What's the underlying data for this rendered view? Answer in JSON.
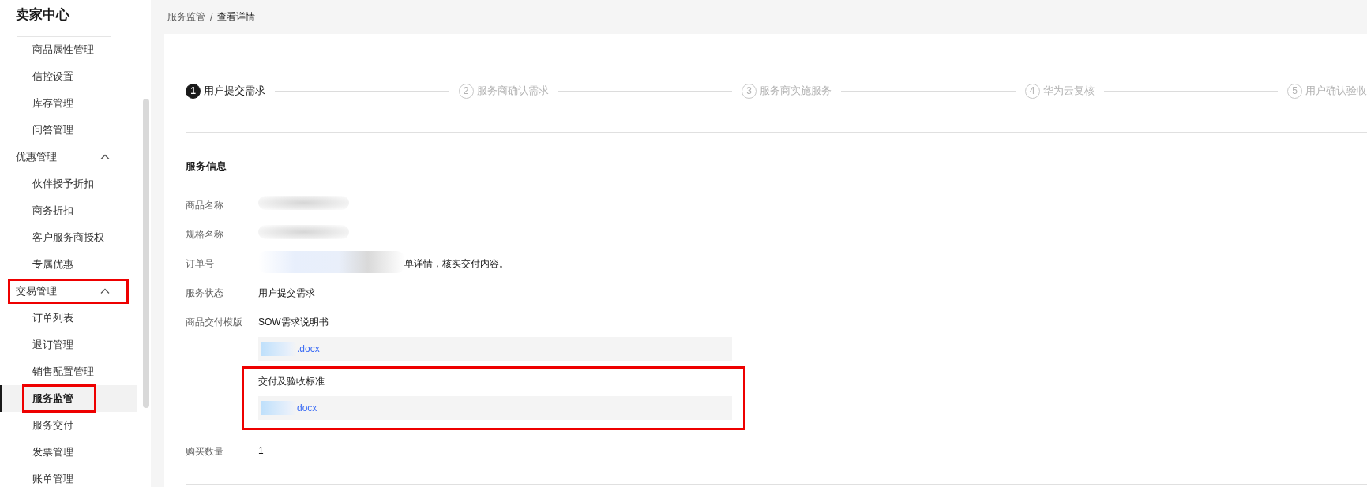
{
  "sidebar": {
    "title": "卖家中心",
    "orphan_items": [
      {
        "label": "商品属性管理",
        "selected": false,
        "annotated": false
      },
      {
        "label": "信控设置",
        "selected": false,
        "annotated": false
      },
      {
        "label": "库存管理",
        "selected": false,
        "annotated": false
      },
      {
        "label": "问答管理",
        "selected": false,
        "annotated": false
      }
    ],
    "groups": [
      {
        "label": "优惠管理",
        "expanded": true,
        "annotated": false,
        "children": [
          {
            "label": "伙伴授予折扣",
            "selected": false,
            "annotated": false
          },
          {
            "label": "商务折扣",
            "selected": false,
            "annotated": false
          },
          {
            "label": "客户服务商授权",
            "selected": false,
            "annotated": false
          },
          {
            "label": "专属优惠",
            "selected": false,
            "annotated": false
          }
        ]
      },
      {
        "label": "交易管理",
        "expanded": true,
        "annotated": true,
        "children": [
          {
            "label": "订单列表",
            "selected": false,
            "annotated": false
          },
          {
            "label": "退订管理",
            "selected": false,
            "annotated": false
          },
          {
            "label": "销售配置管理",
            "selected": false,
            "annotated": false
          },
          {
            "label": "服务监管",
            "selected": true,
            "annotated": true
          },
          {
            "label": "服务交付",
            "selected": false,
            "annotated": false
          },
          {
            "label": "发票管理",
            "selected": false,
            "annotated": false
          },
          {
            "label": "账单管理",
            "selected": false,
            "annotated": false
          }
        ]
      }
    ]
  },
  "breadcrumb": {
    "items": [
      "服务监管",
      "查看详情"
    ],
    "separator": "/"
  },
  "steps": [
    {
      "number": "1",
      "label": "用户提交需求",
      "selected": true
    },
    {
      "number": "2",
      "label": "服务商确认需求",
      "selected": false
    },
    {
      "number": "3",
      "label": "服务商实施服务",
      "selected": false
    },
    {
      "number": "4",
      "label": "华为云复核",
      "selected": false
    },
    {
      "number": "5",
      "label": "用户确认验收",
      "selected": false
    }
  ],
  "section_title": "服务信息",
  "fields": [
    {
      "kind": "text",
      "label": "商品名称",
      "redacted": true
    },
    {
      "kind": "text",
      "label": "规格名称",
      "redacted": true
    },
    {
      "kind": "text",
      "label": "订单号",
      "redacted": true,
      "value": "单详情，核实交付内容。"
    },
    {
      "kind": "text",
      "label": "服务状态",
      "redacted": false,
      "value": "用户提交需求"
    },
    {
      "kind": "files",
      "label": "商品交付模版",
      "files": [
        {
          "title": "SOW需求说明书",
          "file": ".docx",
          "annotated": false
        },
        {
          "title": "交付及验收标准",
          "file": "docx",
          "annotated": true
        }
      ]
    },
    {
      "kind": "text",
      "label": "购买数量",
      "redacted": false,
      "value": "1"
    }
  ]
}
